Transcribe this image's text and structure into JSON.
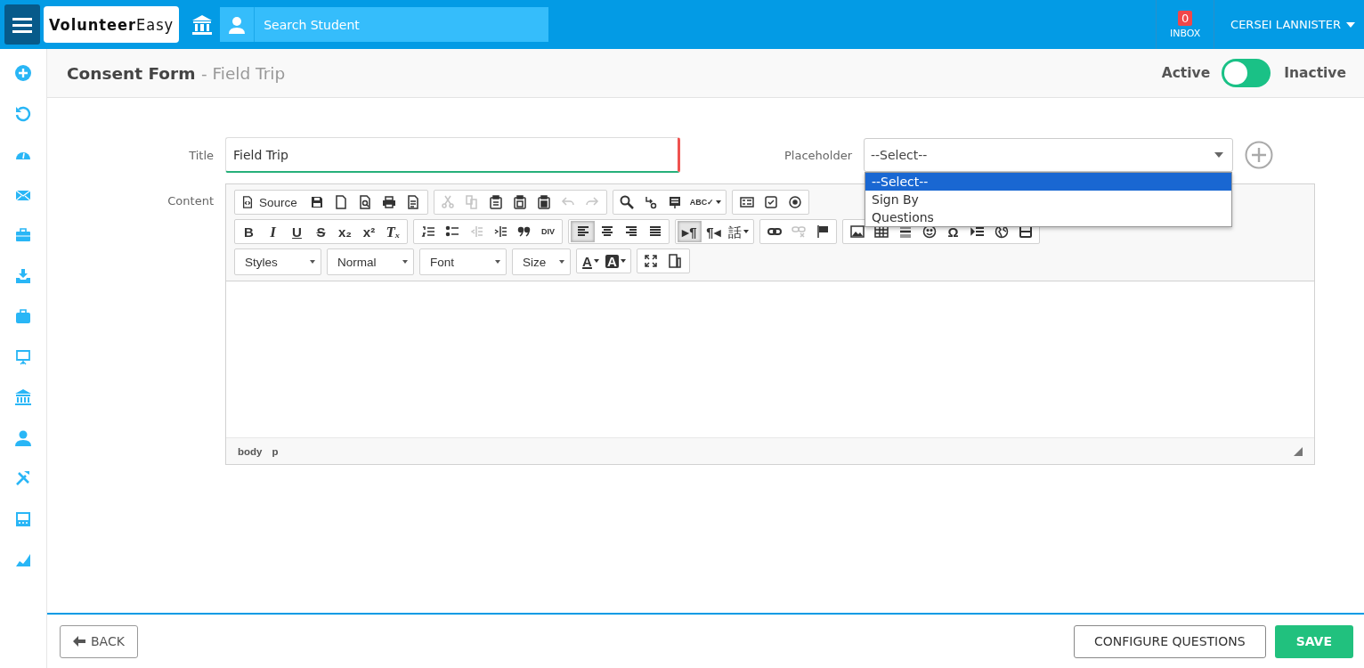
{
  "header": {
    "logo_bold": "Volunteer",
    "logo_light": "Easy",
    "search": {
      "placeholder": "Search Student"
    },
    "inbox": {
      "count": "0",
      "label": "INBOX"
    },
    "user": "CERSEI LANNISTER"
  },
  "page": {
    "title": "Consent Form",
    "subtitle": "- Field Trip",
    "status": {
      "active_label": "Active",
      "inactive_label": "Inactive",
      "inactive": false
    }
  },
  "form": {
    "title": {
      "label": "Title",
      "value": "Field Trip"
    },
    "placeholder": {
      "label": "Placeholder",
      "value": "--Select--",
      "expanded": true,
      "options": [
        {
          "label": "--Select--",
          "selected": true
        },
        {
          "label": "Sign By",
          "selected": false
        },
        {
          "label": "Questions",
          "selected": false
        }
      ]
    },
    "content": {
      "label": "Content",
      "toolbar": [
        [
          [
            {
              "kind": "source",
              "label": "Source",
              "disabled": false,
              "on": false
            },
            {
              "kind": "save",
              "disabled": false,
              "on": false
            },
            {
              "kind": "newpage",
              "disabled": false,
              "on": false
            },
            {
              "kind": "preview",
              "disabled": false,
              "on": false
            },
            {
              "kind": "print",
              "disabled": false,
              "on": false
            },
            {
              "kind": "templates",
              "disabled": false,
              "on": false
            }
          ],
          [
            {
              "kind": "cut",
              "disabled": true,
              "on": false
            },
            {
              "kind": "copy",
              "disabled": true,
              "on": false
            },
            {
              "kind": "paste",
              "disabled": false,
              "on": false
            },
            {
              "kind": "pastetext",
              "disabled": false,
              "on": false
            },
            {
              "kind": "pasteword",
              "disabled": false,
              "on": false
            },
            {
              "kind": "undo",
              "disabled": true,
              "on": false
            },
            {
              "kind": "redo",
              "disabled": true,
              "on": false
            }
          ],
          [
            {
              "kind": "find",
              "disabled": false,
              "on": false
            },
            {
              "kind": "replace",
              "disabled": false,
              "on": false
            },
            {
              "kind": "selectall",
              "disabled": false,
              "on": false
            },
            {
              "kind": "spellcheck",
              "label": "ABC✓",
              "disabled": false,
              "on": false
            }
          ],
          [
            {
              "kind": "form",
              "disabled": false,
              "on": false
            },
            {
              "kind": "checkbox",
              "disabled": false,
              "on": false
            },
            {
              "kind": "radio",
              "disabled": false,
              "on": false
            }
          ]
        ],
        [
          [
            {
              "kind": "bold",
              "label": "B",
              "disabled": false,
              "on": false
            },
            {
              "kind": "italic",
              "label": "I",
              "disabled": false,
              "on": false
            },
            {
              "kind": "underline",
              "label": "U",
              "disabled": false,
              "on": false
            },
            {
              "kind": "strike",
              "label": "S",
              "disabled": false,
              "on": false
            },
            {
              "kind": "subscript",
              "label": "x₂",
              "disabled": false,
              "on": false
            },
            {
              "kind": "superscript",
              "label": "x²",
              "disabled": false,
              "on": false
            },
            {
              "kind": "removeformat",
              "label": "Tₓ",
              "disabled": false,
              "on": false
            }
          ],
          [
            {
              "kind": "ol",
              "disabled": false,
              "on": false
            },
            {
              "kind": "ul",
              "disabled": false,
              "on": false
            },
            {
              "kind": "outdent",
              "disabled": true,
              "on": false
            },
            {
              "kind": "indent",
              "disabled": false,
              "on": false
            },
            {
              "kind": "blockquote",
              "disabled": false,
              "on": false
            },
            {
              "kind": "div",
              "label": "DIV",
              "disabled": false,
              "on": false
            }
          ],
          [
            {
              "kind": "alignleft",
              "disabled": false,
              "on": true
            },
            {
              "kind": "aligncenter",
              "disabled": false,
              "on": false
            },
            {
              "kind": "alignright",
              "disabled": false,
              "on": false
            },
            {
              "kind": "justify",
              "disabled": false,
              "on": false
            }
          ],
          [
            {
              "kind": "ltr",
              "label": "▸¶",
              "disabled": false,
              "on": true
            },
            {
              "kind": "rtl",
              "label": "¶◂",
              "disabled": false,
              "on": false
            },
            {
              "kind": "language",
              "label": "話",
              "disabled": false,
              "on": false
            }
          ],
          [
            {
              "kind": "link",
              "disabled": false,
              "on": false
            },
            {
              "kind": "unlink",
              "disabled": true,
              "on": false
            },
            {
              "kind": "anchor",
              "disabled": false,
              "on": false
            }
          ],
          [
            {
              "kind": "image",
              "disabled": false,
              "on": false
            },
            {
              "kind": "table",
              "disabled": false,
              "on": false
            },
            {
              "kind": "hr",
              "disabled": false,
              "on": false
            },
            {
              "kind": "smiley",
              "disabled": false,
              "on": false
            },
            {
              "kind": "specialchar",
              "label": "Ω",
              "disabled": false,
              "on": false
            },
            {
              "kind": "pagebreak",
              "disabled": false,
              "on": false
            },
            {
              "kind": "globe",
              "disabled": false,
              "on": false
            },
            {
              "kind": "youtube",
              "disabled": false,
              "on": false
            }
          ]
        ],
        [
          [
            {
              "kind": "combo",
              "label": "Styles"
            }
          ],
          [
            {
              "kind": "combo",
              "label": "Normal"
            }
          ],
          [
            {
              "kind": "combo",
              "label": "Font"
            }
          ],
          [
            {
              "kind": "sizecombo",
              "label": "Size"
            }
          ],
          [
            {
              "kind": "textcolor",
              "label": "A",
              "disabled": false,
              "on": false
            },
            {
              "kind": "bgcolor",
              "label": "A",
              "disabled": false,
              "on": false
            }
          ],
          [
            {
              "kind": "maximize",
              "disabled": false,
              "on": false
            },
            {
              "kind": "showblocks",
              "disabled": false,
              "on": false
            }
          ]
        ]
      ],
      "path": [
        "body",
        "p"
      ]
    }
  },
  "footer": {
    "back": "BACK",
    "configure": "CONFIGURE QUESTIONS",
    "save": "SAVE"
  }
}
